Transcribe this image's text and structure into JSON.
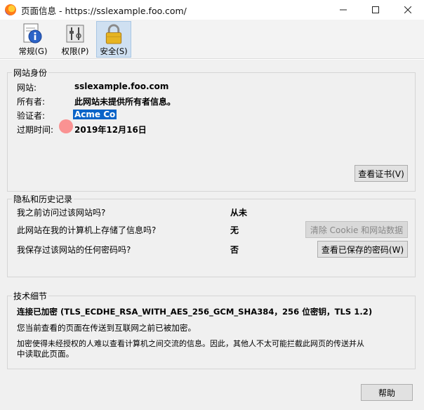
{
  "window": {
    "title": "页面信息 - https://sslexample.foo.com/"
  },
  "tabs": [
    {
      "label": "常规(G)",
      "icon": "info-icon",
      "active": false
    },
    {
      "label": "权限(P)",
      "icon": "permissions-icon",
      "active": false
    },
    {
      "label": "安全(S)",
      "icon": "lock-icon",
      "active": true
    }
  ],
  "identity": {
    "legend": "网站身份",
    "website_label": "网站:",
    "website_value": "sslexample.foo.com",
    "owner_label": "所有者:",
    "owner_value": "此网站未提供所有者信息。",
    "verifier_label": "验证者:",
    "verifier_value": "Acme Co",
    "expires_label": "过期时间:",
    "expires_value": "2019年12月16日",
    "view_cert_button": "查看证书(V)"
  },
  "privacy": {
    "legend": "隐私和历史记录",
    "q1": "我之前访问过该网站吗?",
    "a1": "从未",
    "q2": "此网站在我的计算机上存储了信息吗?",
    "a2": "无",
    "clear_button": "清除 Cookie 和网站数据",
    "q3": "我保存过该网站的任何密码吗?",
    "a3": "否",
    "view_passwords_button": "查看已保存的密码(W)"
  },
  "technical": {
    "legend": "技术细节",
    "line1": "连接已加密 (TLS_ECDHE_RSA_WITH_AES_256_GCM_SHA384，256 位密钥，TLS 1.2)",
    "line2": "您当前查看的页面在传送到互联网之前已被加密。",
    "line3": "加密使得未经授权的人难以查看计算机之间交流的信息。因此，其他人不太可能拦截此网页的传送并从",
    "line4": "中读取此页面。"
  },
  "footer": {
    "help_button": "帮助"
  },
  "colors": {
    "active_tab_bg": "#cfe0f1",
    "selection": "#0a64c8",
    "cursor_highlight": "#ff5f5f"
  }
}
